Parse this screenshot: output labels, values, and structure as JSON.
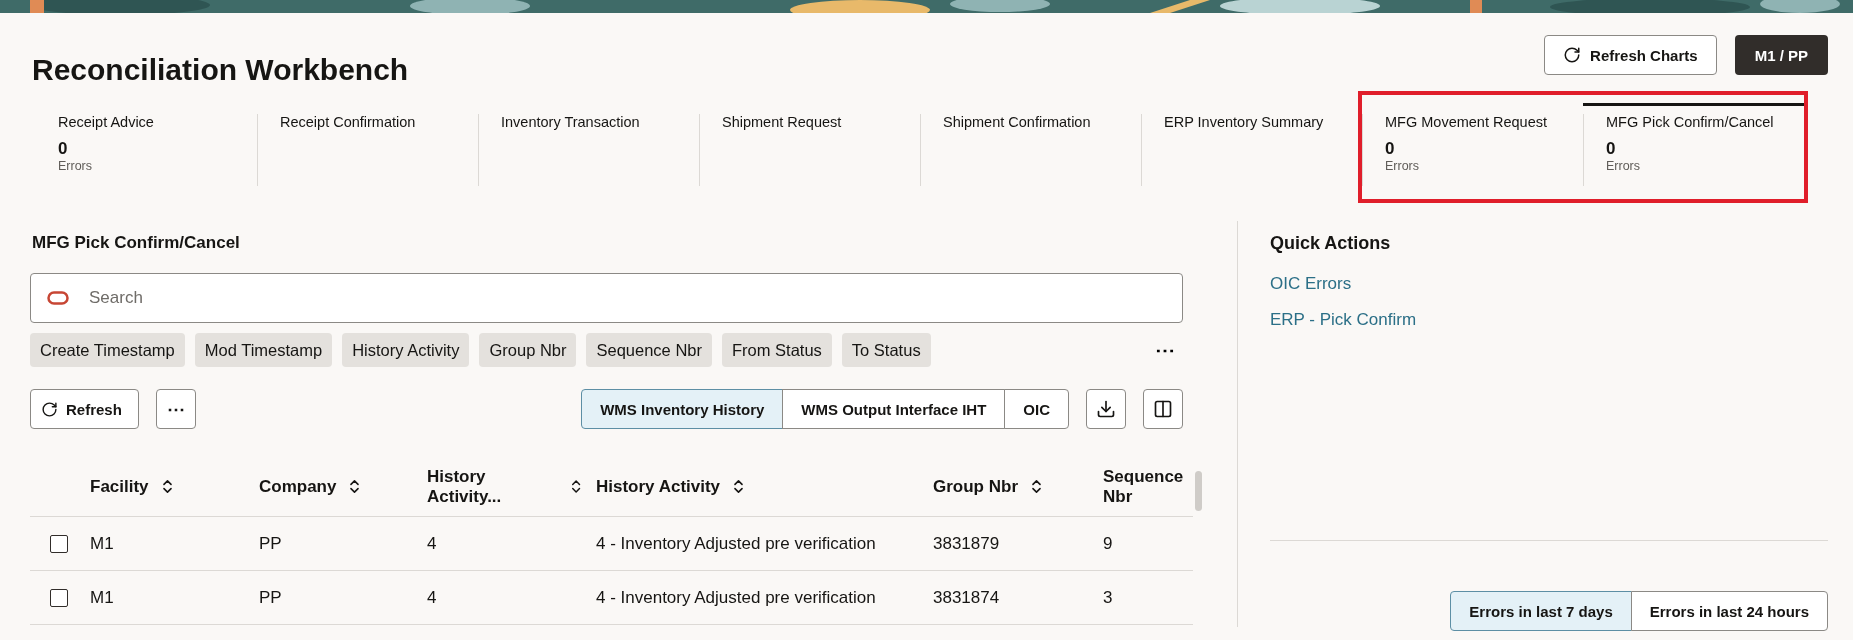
{
  "page": {
    "title": "Reconciliation Workbench",
    "refresh_button": "Refresh Charts",
    "context_button": "M1 / PP"
  },
  "tiles": [
    {
      "label": "Receipt Advice",
      "count": "0",
      "caption": "Errors",
      "selected": false,
      "highlighted": false
    },
    {
      "label": "Receipt Confirmation",
      "selected": false,
      "highlighted": false
    },
    {
      "label": "Inventory Transaction",
      "selected": false,
      "highlighted": false
    },
    {
      "label": "Shipment Request",
      "selected": false,
      "highlighted": false
    },
    {
      "label": "Shipment Confirmation",
      "selected": false,
      "highlighted": false
    },
    {
      "label": "ERP Inventory Summary",
      "selected": false,
      "highlighted": false
    },
    {
      "label": "MFG Movement Request",
      "count": "0",
      "caption": "Errors",
      "selected": false,
      "highlighted": true
    },
    {
      "label": "MFG Pick Confirm/Cancel",
      "count": "0",
      "caption": "Errors",
      "selected": true,
      "highlighted": true
    }
  ],
  "section": {
    "title": "MFG Pick Confirm/Cancel",
    "search": {
      "placeholder": "Search"
    },
    "filter_chips": [
      "Create Timestamp",
      "Mod Timestamp",
      "History Activity",
      "Group Nbr",
      "Sequence Nbr",
      "From Status",
      "To Status"
    ],
    "more_chips": "⋯",
    "refresh_button": "Refresh",
    "more_button": "⋯",
    "views": [
      {
        "label": "WMS Inventory History",
        "selected": true
      },
      {
        "label": "WMS Output Interface IHT",
        "selected": false
      },
      {
        "label": "OIC",
        "selected": false
      }
    ],
    "table": {
      "columns": [
        "Facility",
        "Company",
        "History Activity...",
        "History Activity",
        "Group Nbr",
        "Sequence Nbr"
      ],
      "rows": [
        {
          "checked": false,
          "cells": [
            "M1",
            "PP",
            "4",
            "4 - Inventory Adjusted pre verification",
            "3831879",
            "9"
          ]
        },
        {
          "checked": false,
          "cells": [
            "M1",
            "PP",
            "4",
            "4 - Inventory Adjusted pre verification",
            "3831874",
            "3"
          ]
        }
      ]
    }
  },
  "quick_actions": {
    "title": "Quick Actions",
    "links": [
      "OIC Errors",
      "ERP - Pick Confirm"
    ],
    "ranges": [
      {
        "label": "Errors in last 7 days",
        "selected": true
      },
      {
        "label": "Errors in last 24 hours",
        "selected": false
      }
    ]
  }
}
